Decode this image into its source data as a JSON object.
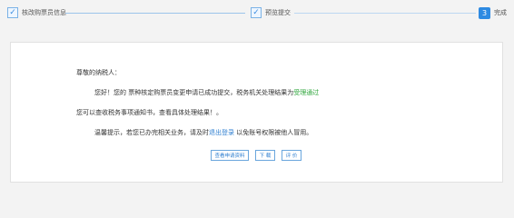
{
  "steps": [
    {
      "label": "核改购票员信息",
      "state": "done"
    },
    {
      "label": "预览提交",
      "state": "done"
    },
    {
      "number": "3",
      "label": "完成",
      "state": "current"
    }
  ],
  "message": {
    "greeting": "尊敬的纳税人：",
    "line1_prefix": "您好！您的 票种核定购票员变更申请已成功提交，税务机关处理结果为",
    "line1_status": "受理通过",
    "line2": "您可以查收税务事项通知书，查看具体处理结果！。",
    "line3_prefix": "温馨提示，若您已办完相关业务，请及时",
    "line3_link": "退出登录",
    "line3_suffix": "以免账号权限被他人冒用。"
  },
  "buttons": {
    "view": "查看申请资料",
    "download": "下 载",
    "evaluate": "评 价"
  },
  "colors": {
    "accent": "#2d8ae2",
    "status_green": "#2fa63c",
    "link_blue": "#2f7fd0"
  }
}
